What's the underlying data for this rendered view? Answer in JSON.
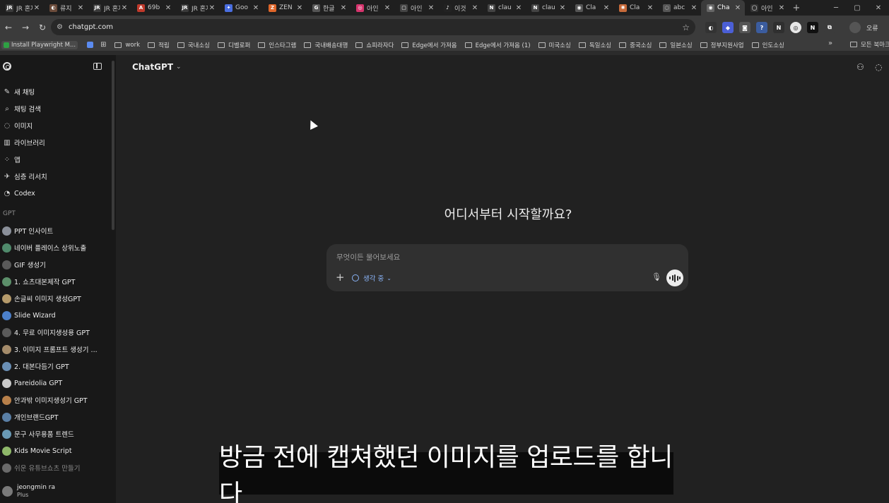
{
  "browser": {
    "tabs": [
      {
        "label": "JR 혼자",
        "fav": "JR",
        "color": "#3a3a3a"
      },
      {
        "label": "류지",
        "fav": "◐",
        "color": "#6b4b3a"
      },
      {
        "label": "JR 혼지",
        "fav": "JR",
        "color": "#3a3a3a"
      },
      {
        "label": "69b",
        "fav": "A",
        "color": "#c0392b"
      },
      {
        "label": "JR 혼지",
        "fav": "JR",
        "color": "#3a3a3a"
      },
      {
        "label": "Goo",
        "fav": "✦",
        "color": "#4a6ee0"
      },
      {
        "label": "ZEN",
        "fav": "Z",
        "color": "#e0662a"
      },
      {
        "label": "한글",
        "fav": "G",
        "color": "#555555"
      },
      {
        "label": "아인",
        "fav": "◎",
        "color": "#d6336c"
      },
      {
        "label": "아인",
        "fav": "▢",
        "color": "#444444"
      },
      {
        "label": "이것",
        "fav": "♪",
        "color": "#222222"
      },
      {
        "label": "clau",
        "fav": "N",
        "color": "#444444"
      },
      {
        "label": "clau",
        "fav": "N",
        "color": "#444444"
      },
      {
        "label": "Cla",
        "fav": "◉",
        "color": "#555555"
      },
      {
        "label": "Cla",
        "fav": "✺",
        "color": "#c76a3a"
      },
      {
        "label": "abc",
        "fav": "◌",
        "color": "#555555"
      },
      {
        "label": "Cha",
        "fav": "◉",
        "color": "#666666",
        "active": true
      },
      {
        "label": "아인",
        "fav": "◯",
        "color": "#333333"
      }
    ],
    "new_tab": "+",
    "window_controls": [
      "─",
      "▢",
      "✕"
    ],
    "url": "chatgpt.com",
    "extensions": [
      {
        "glyph": "◐",
        "color": "#333333"
      },
      {
        "glyph": "◆",
        "color": "#4b5fd6"
      },
      {
        "glyph": "◙",
        "color": "#555555"
      },
      {
        "glyph": "?",
        "color": "#3b5c9e"
      },
      {
        "glyph": "N",
        "color": "#2f2f2f"
      },
      {
        "glyph": "◎",
        "color": "#e8e8e8"
      },
      {
        "glyph": "N",
        "color": "#111111"
      },
      {
        "glyph": "⧉",
        "color": "#3b3b3b"
      }
    ],
    "profile_label": "오류",
    "bookmarks": {
      "playwright": "Install Playwright M...",
      "folders": [
        "work",
        "적립",
        "국내소싱",
        "디벨로퍼",
        "인스타그램",
        "국내배송대행",
        "쇼피라자다",
        "Edge에서 가져옴",
        "Edge에서 가져옴 (1)",
        "미국소싱",
        "독일소싱",
        "중국소싱",
        "일본소싱",
        "정부지원사업",
        "인도소싱"
      ],
      "more": "»",
      "all": "모든 북마크"
    }
  },
  "sidebar": {
    "nav": [
      {
        "label": "새 채팅",
        "icon": "✎",
        "icon_name": "new-chat-icon"
      },
      {
        "label": "채팅 검색",
        "icon": "⌕",
        "icon_name": "search-icon"
      },
      {
        "label": "이미지",
        "icon": "◌",
        "icon_name": "image-icon"
      },
      {
        "label": "라이브러리",
        "icon": "▥",
        "icon_name": "library-icon"
      },
      {
        "label": "앱",
        "icon": "⁘",
        "icon_name": "apps-icon"
      },
      {
        "label": "심층 리서치",
        "icon": "✈",
        "icon_name": "deep-research-icon"
      },
      {
        "label": "Codex",
        "icon": "◔",
        "icon_name": "codex-icon"
      }
    ],
    "section_title": "GPT",
    "gpts": [
      {
        "label": "PPT 인사이트",
        "color": "#8a8f99"
      },
      {
        "label": "네이버 플레이스 상위노출",
        "color": "#4f8a6b"
      },
      {
        "label": "GIF 생성기",
        "color": "#5a5a5a"
      },
      {
        "label": "1. 쇼츠대본제작 GPT",
        "color": "#5c8f6a"
      },
      {
        "label": "손글씨 이미지 생성GPT",
        "color": "#b59a6a"
      },
      {
        "label": "Slide Wizard",
        "color": "#4b7fc9"
      },
      {
        "label": "4. 무료 이미지생성용 GPT",
        "color": "#5a5a5a"
      },
      {
        "label": "3. 이미지 프롬프트 생성기 ...",
        "color": "#a48b6a"
      },
      {
        "label": "2. 대본다듬기 GPT",
        "color": "#6a8fb5"
      },
      {
        "label": "Pareidolia GPT",
        "color": "#c9c9c9"
      },
      {
        "label": "안과밖 이미지생성기 GPT",
        "color": "#b8804a"
      },
      {
        "label": "개인브랜드GPT",
        "color": "#5a7fa5"
      },
      {
        "label": "문구 사무용품 트렌드",
        "color": "#6a9ab5"
      },
      {
        "label": "Kids Movie Script",
        "color": "#8fb86a"
      },
      {
        "label": "쉬운 유튜브쇼츠 만들기",
        "color": "#6a6a6a",
        "faded": true
      }
    ],
    "user": {
      "name": "jeongmin ra",
      "plan": "Plus"
    }
  },
  "main": {
    "model_name": "ChatGPT",
    "hero": "어디서부터 시작할까요?",
    "composer": {
      "placeholder": "무엇이든 물어보세요",
      "mode_label": "생각 중"
    }
  },
  "subtitle": "방금 전에 캡쳐했던 이미지를 업로드를 합니다"
}
